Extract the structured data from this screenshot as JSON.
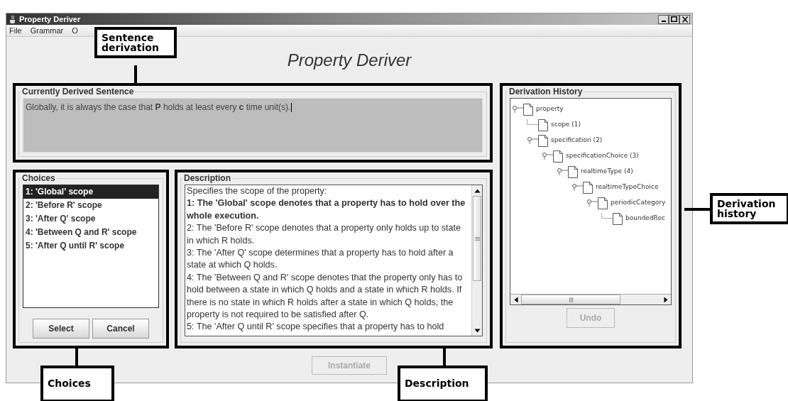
{
  "window": {
    "title": "Property Deriver"
  },
  "menu": [
    {
      "label": "File"
    },
    {
      "label": "Grammar"
    },
    {
      "label": "O"
    }
  ],
  "heading": "Property Deriver",
  "sentence_panel": {
    "title": "Currently Derived Sentence",
    "text": "Globally, it is always the case that **P** holds at least every **c** time unit(s)."
  },
  "choices_panel": {
    "title": "Choices",
    "items": [
      {
        "label": "1: 'Global' scope",
        "selected": true
      },
      {
        "label": "2: 'Before R' scope",
        "selected": false
      },
      {
        "label": "3: 'After Q' scope",
        "selected": false
      },
      {
        "label": "4: 'Between Q and R' scope",
        "selected": false
      },
      {
        "label": "5: 'After Q until R' scope",
        "selected": false
      }
    ],
    "buttons": [
      {
        "label": "Select",
        "disabled": false
      },
      {
        "label": "Cancel",
        "disabled": false
      }
    ]
  },
  "description_panel": {
    "title": "Description",
    "paragraphs": [
      {
        "text": "Specifies the scope of the property:",
        "bold": false
      },
      {
        "text": "1: The 'Global' scope denotes that a property has to hold over the whole execution.",
        "bold": true
      },
      {
        "text": "2: The 'Before R' scope denotes that a property only holds up to state in which R holds.",
        "bold": false
      },
      {
        "text": "3: The 'After Q' scope determines that a property has to hold after a state at which Q holds.",
        "bold": false
      },
      {
        "text": "4: The 'Between Q and R' scope denotes that the property only has to hold between a state in which Q holds and a state in which R holds. If there is no state in which R holds after a state in which Q holds, the property is not required to be satisfied after Q.",
        "bold": false
      },
      {
        "text": "5: The 'After Q until R' scope specifies that a property has to hold",
        "bold": false
      }
    ]
  },
  "history_panel": {
    "title": "Derivation History",
    "tree": [
      {
        "label": "property",
        "children": [
          {
            "label": "scope (1)"
          },
          {
            "label": "specification (2)",
            "children": [
              {
                "label": "specificationChoice (3)",
                "children": [
                  {
                    "label": "realtimeType (4)",
                    "children": [
                      {
                        "label": "realtimeTypeChoice",
                        "children": [
                          {
                            "label": "periodicCategory",
                            "children": [
                              {
                                "label": "boundedRec"
                              }
                            ]
                          }
                        ]
                      }
                    ]
                  }
                ]
              }
            ]
          }
        ]
      }
    ],
    "button": {
      "label": "Undo",
      "disabled": true
    }
  },
  "instantiate_button": {
    "label": "Instantiate",
    "disabled": true
  },
  "annotations": [
    {
      "label": "Sentence derivation"
    },
    {
      "label": "Choices"
    },
    {
      "label": "Description"
    },
    {
      "label": "Derivation history"
    }
  ]
}
